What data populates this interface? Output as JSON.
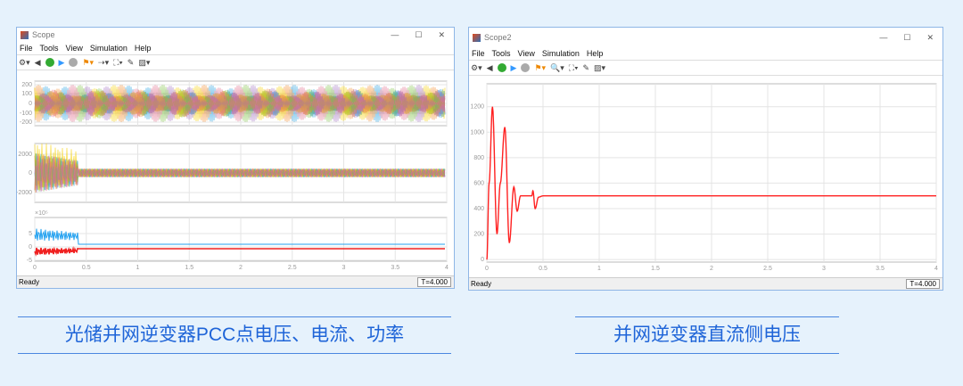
{
  "scope1": {
    "title": "Scope",
    "menu": [
      "File",
      "Tools",
      "View",
      "Simulation",
      "Help"
    ],
    "status": "Ready",
    "time": "T=4.000",
    "panel1_yticks": [
      "200",
      "100",
      "0",
      "-100",
      "-200"
    ],
    "panel2_yticks": [
      "2000",
      "0",
      "-2000"
    ],
    "panel3_yticks": [
      "5",
      "0",
      "-5"
    ],
    "panel3_exp": "×10⁵",
    "xticks": [
      "0",
      "0.5",
      "1",
      "1.5",
      "2",
      "2.5",
      "3",
      "3.5",
      "4"
    ]
  },
  "scope2": {
    "title": "Scope2",
    "menu": [
      "File",
      "Tools",
      "View",
      "Simulation",
      "Help"
    ],
    "status": "Ready",
    "time": "T=4.000"
  },
  "captions": {
    "left": "光储并网逆变器PCC点电压、电流、功率",
    "right": "并网逆变器直流侧电压"
  },
  "chart_data": {
    "type": "line",
    "title": "Scope2",
    "x": [
      0,
      0.02,
      0.05,
      0.09,
      0.12,
      0.16,
      0.2,
      0.24,
      0.27,
      0.3,
      0.4,
      0.41,
      0.43,
      0.46,
      0.5,
      4
    ],
    "values": [
      0,
      600,
      1200,
      200,
      600,
      1040,
      130,
      570,
      380,
      500,
      500,
      540,
      400,
      490,
      500,
      500
    ],
    "xticks": [
      "0",
      "0.5",
      "1",
      "1.5",
      "2",
      "2.5",
      "3",
      "3.5",
      "4"
    ],
    "yticks": [
      "0",
      "200",
      "400",
      "600",
      "800",
      "1000",
      "1200"
    ],
    "xlim": [
      0,
      4
    ],
    "ylim": [
      -20,
      1380
    ],
    "color": "#ff2020"
  }
}
